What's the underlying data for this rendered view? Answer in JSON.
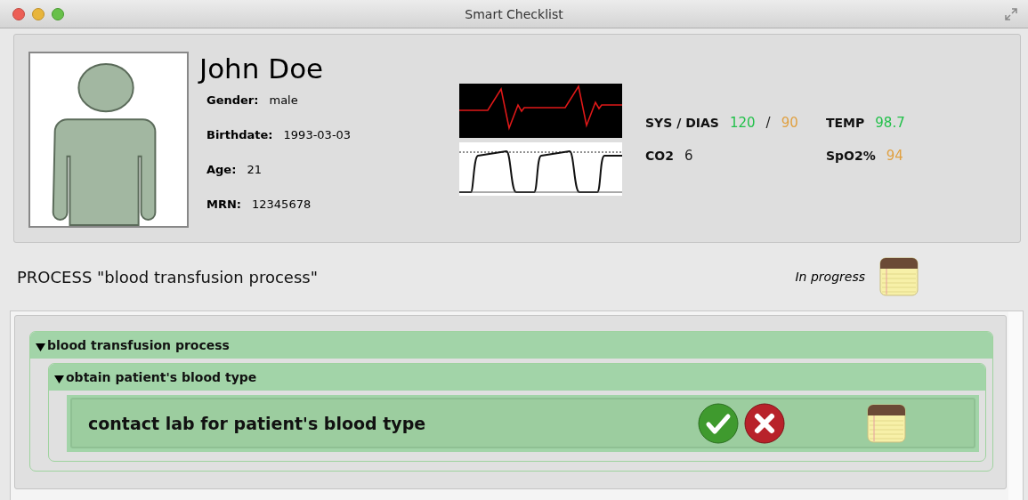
{
  "window": {
    "title": "Smart Checklist"
  },
  "patient": {
    "name": "John Doe",
    "fields": [
      {
        "label": "Gender:",
        "value": "male"
      },
      {
        "label": "Birthdate:",
        "value": "1993-03-03"
      },
      {
        "label": "Age:",
        "value": "21"
      },
      {
        "label": "MRN:",
        "value": "12345678"
      }
    ]
  },
  "vitals": [
    {
      "label": "SYS / DIAS",
      "values": [
        {
          "text": "120",
          "color": "#22c04a"
        },
        {
          "text": "/",
          "color": "#222222"
        },
        {
          "text": "90",
          "color": "#e0a040"
        }
      ]
    },
    {
      "label": "TEMP",
      "values": [
        {
          "text": "98.7",
          "color": "#22c04a"
        }
      ]
    },
    {
      "label": "CO2",
      "values": [
        {
          "text": "6",
          "color": "#222222"
        }
      ]
    },
    {
      "label": "SpO2%",
      "values": [
        {
          "text": "94",
          "color": "#e0a040"
        }
      ]
    }
  ],
  "process": {
    "title": "PROCESS \"blood transfusion process\"",
    "status": "In progress"
  },
  "tree": [
    {
      "kind": "group",
      "label": "blood transfusion process",
      "expanded": true,
      "children": [
        {
          "kind": "group",
          "label": "obtain patient's blood type",
          "expanded": true,
          "children": [
            {
              "kind": "task",
              "label": "contact lab for patient's blood type"
            }
          ]
        }
      ]
    }
  ]
}
